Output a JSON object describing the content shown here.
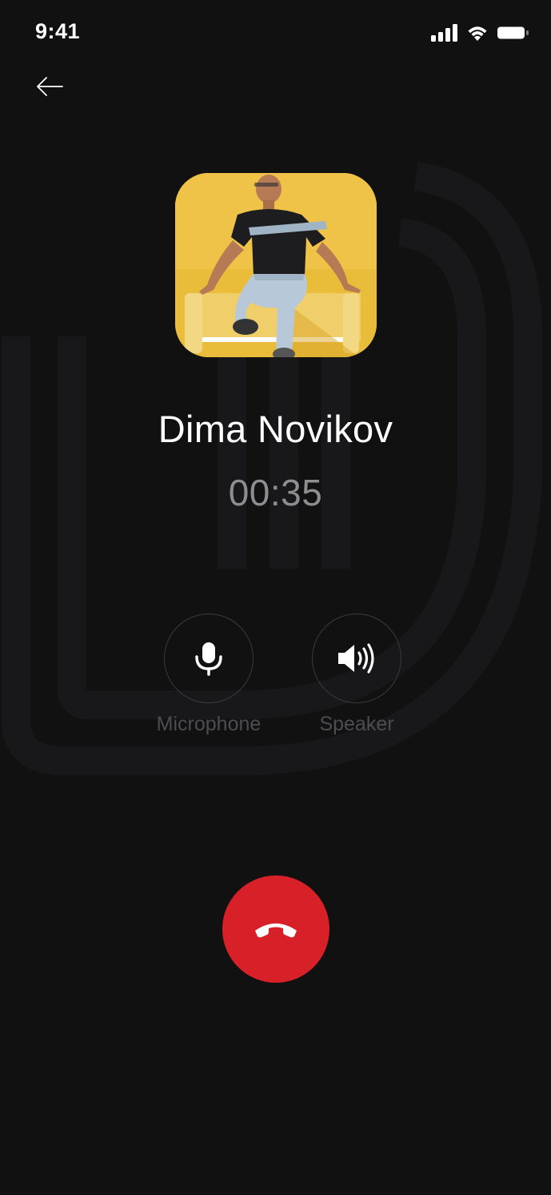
{
  "status_bar": {
    "time": "9:41",
    "icons": [
      "signal-icon",
      "wifi-icon",
      "battery-icon"
    ]
  },
  "nav": {
    "back_icon": "arrow-left-icon"
  },
  "caller": {
    "name": "Dima Novikov",
    "duration": "00:35"
  },
  "controls": [
    {
      "id": "microphone",
      "label": "Microphone",
      "icon": "microphone-icon"
    },
    {
      "id": "speaker",
      "label": "Speaker",
      "icon": "speaker-icon"
    }
  ],
  "end_call": {
    "icon": "phone-hangup-icon"
  },
  "colors": {
    "background": "#111112",
    "end_call": "#d72027",
    "timer": "#8e8e90",
    "label": "#4d4d50"
  }
}
